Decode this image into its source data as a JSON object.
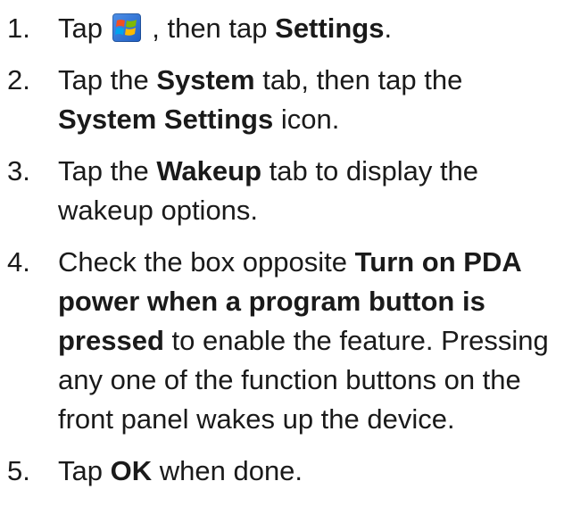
{
  "steps": [
    {
      "number": "1.",
      "parts": {
        "a": "Tap",
        "b": ", then tap",
        "c": "Settings",
        "d": "."
      },
      "icon": "windows-start-icon"
    },
    {
      "number": "2.",
      "parts": {
        "a": "Tap the",
        "b": "System",
        "c": "tab, then tap the",
        "d": "System Settings",
        "e": "icon."
      }
    },
    {
      "number": "3.",
      "parts": {
        "a": "Tap the",
        "b": "Wakeup",
        "c": "tab to display the wakeup options."
      }
    },
    {
      "number": "4.",
      "parts": {
        "a": "Check the box opposite",
        "b": "Turn on PDA power when a program button is pressed",
        "c": "to enable the feature. Pressing any one of the function buttons on the front panel wakes up the device."
      }
    },
    {
      "number": "5.",
      "parts": {
        "a": "Tap",
        "b": "OK",
        "c": "when done."
      }
    }
  ]
}
